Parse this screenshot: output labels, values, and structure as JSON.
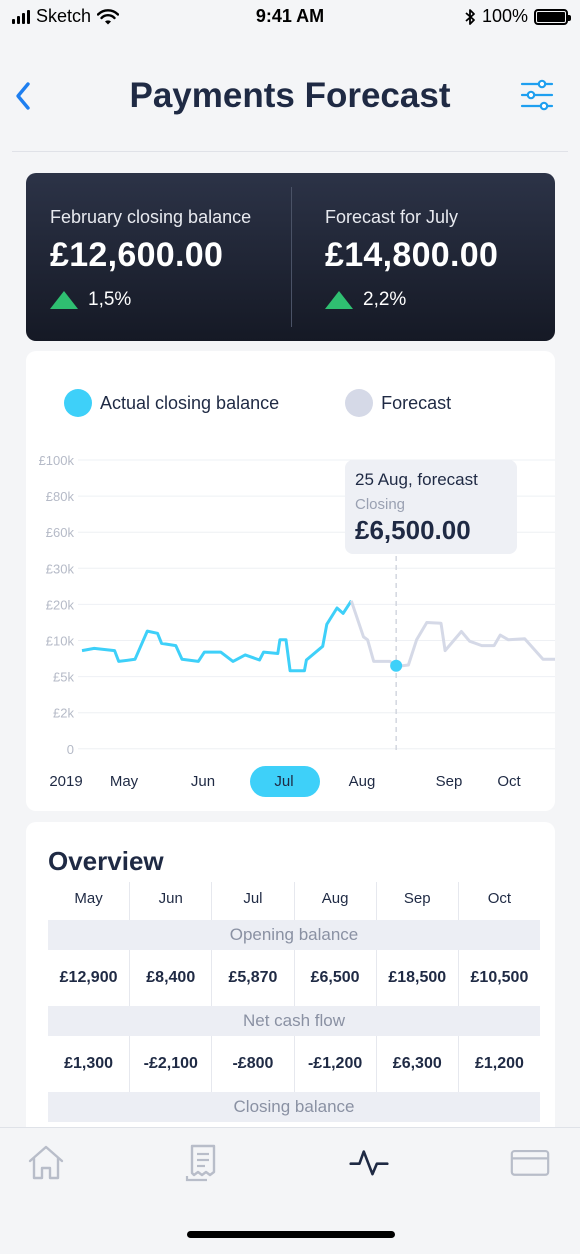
{
  "status_bar": {
    "carrier": "Sketch",
    "time": "9:41 AM",
    "battery": "100%"
  },
  "nav": {
    "title": "Payments Forecast",
    "back_icon": "chevron-left-icon",
    "filter_icon": "sliders-icon"
  },
  "summary": {
    "left": {
      "label": "February closing balance",
      "amount": "£12,600.00",
      "change": "1,5%"
    },
    "right": {
      "label": "Forecast for July",
      "amount": "£14,800.00",
      "change": "2,2%"
    },
    "up_color": "#2fbf71"
  },
  "legend": {
    "actual": {
      "label": "Actual closing balance",
      "color": "#3ed0f9"
    },
    "forecast": {
      "label": "Forecast",
      "color": "#d5d9e7"
    }
  },
  "tooltip": {
    "title": "25 Aug, forecast",
    "subtitle": "Closing",
    "value": "£6,500.00"
  },
  "chart_data": {
    "type": "line",
    "y_tick_labels": [
      "£100k",
      "£80k",
      "£60k",
      "£30k",
      "£20k",
      "£10k",
      "£5k",
      "£2k",
      "0"
    ],
    "x_tick_labels": [
      "2019",
      "May",
      "Jun",
      "Jul",
      "Aug",
      "Sep",
      "Oct"
    ],
    "selected_month": "Jul",
    "grid": true,
    "series": [
      {
        "name": "Actual closing balance",
        "color": "#3ed0f9",
        "points": [
          [
            0.0,
            8.6
          ],
          [
            0.3,
            8.9
          ],
          [
            0.8,
            8.6
          ],
          [
            0.9,
            7.1
          ],
          [
            1.3,
            7.4
          ],
          [
            1.6,
            12.6
          ],
          [
            1.85,
            12.0
          ],
          [
            1.95,
            9.6
          ],
          [
            2.3,
            9.3
          ],
          [
            2.45,
            7.4
          ],
          [
            2.85,
            7.1
          ],
          [
            3.0,
            8.4
          ],
          [
            3.4,
            8.4
          ],
          [
            3.7,
            7.1
          ],
          [
            4.0,
            8.0
          ],
          [
            4.35,
            7.3
          ],
          [
            4.45,
            8.4
          ],
          [
            4.8,
            8.2
          ],
          [
            4.85,
            10.2
          ],
          [
            5.0,
            10.2
          ],
          [
            5.1,
            5.8
          ],
          [
            5.45,
            5.8
          ],
          [
            5.5,
            7.3
          ],
          [
            5.9,
            9.2
          ],
          [
            6.0,
            14.5
          ],
          [
            6.25,
            19.0
          ],
          [
            6.4,
            17.5
          ],
          [
            6.6,
            21.0
          ]
        ]
      },
      {
        "name": "Forecast",
        "color": "#d5d9e7",
        "points": [
          [
            6.6,
            21.0
          ],
          [
            6.9,
            11.0
          ],
          [
            7.0,
            10.2
          ],
          [
            7.15,
            7.1
          ],
          [
            7.55,
            7.1
          ],
          [
            7.7,
            6.4
          ],
          [
            8.0,
            6.6
          ],
          [
            8.2,
            10.2
          ],
          [
            8.45,
            15.0
          ],
          [
            8.8,
            14.8
          ],
          [
            8.9,
            8.6
          ],
          [
            9.3,
            12.5
          ],
          [
            9.5,
            9.9
          ],
          [
            9.8,
            9.3
          ],
          [
            10.1,
            9.3
          ],
          [
            10.25,
            11.5
          ],
          [
            10.45,
            10.2
          ],
          [
            10.85,
            10.5
          ],
          [
            11.3,
            7.4
          ],
          [
            11.6,
            7.4
          ]
        ]
      }
    ],
    "highlight": {
      "x": 7.7,
      "y": 6.5,
      "label": "25 Aug, forecast"
    }
  },
  "overview": {
    "title": "Overview",
    "months": [
      "May",
      "Jun",
      "Jul",
      "Aug",
      "Sep",
      "Oct"
    ],
    "sections": [
      {
        "label": "Opening balance",
        "values": [
          "£12,900",
          "£8,400",
          "£5,870",
          "£6,500",
          "£18,500",
          "£10,500"
        ]
      },
      {
        "label": "Net cash flow",
        "values": [
          "£1,300",
          "-£2,100",
          "-£800",
          "-£1,200",
          "£6,300",
          "£1,200"
        ]
      },
      {
        "label": "Closing balance"
      }
    ]
  },
  "tab_bar": {
    "tabs": [
      {
        "icon": "home-icon",
        "active": false
      },
      {
        "icon": "receipt-icon",
        "active": false
      },
      {
        "icon": "activity-icon",
        "active": true
      },
      {
        "icon": "card-icon",
        "active": false
      }
    ]
  }
}
